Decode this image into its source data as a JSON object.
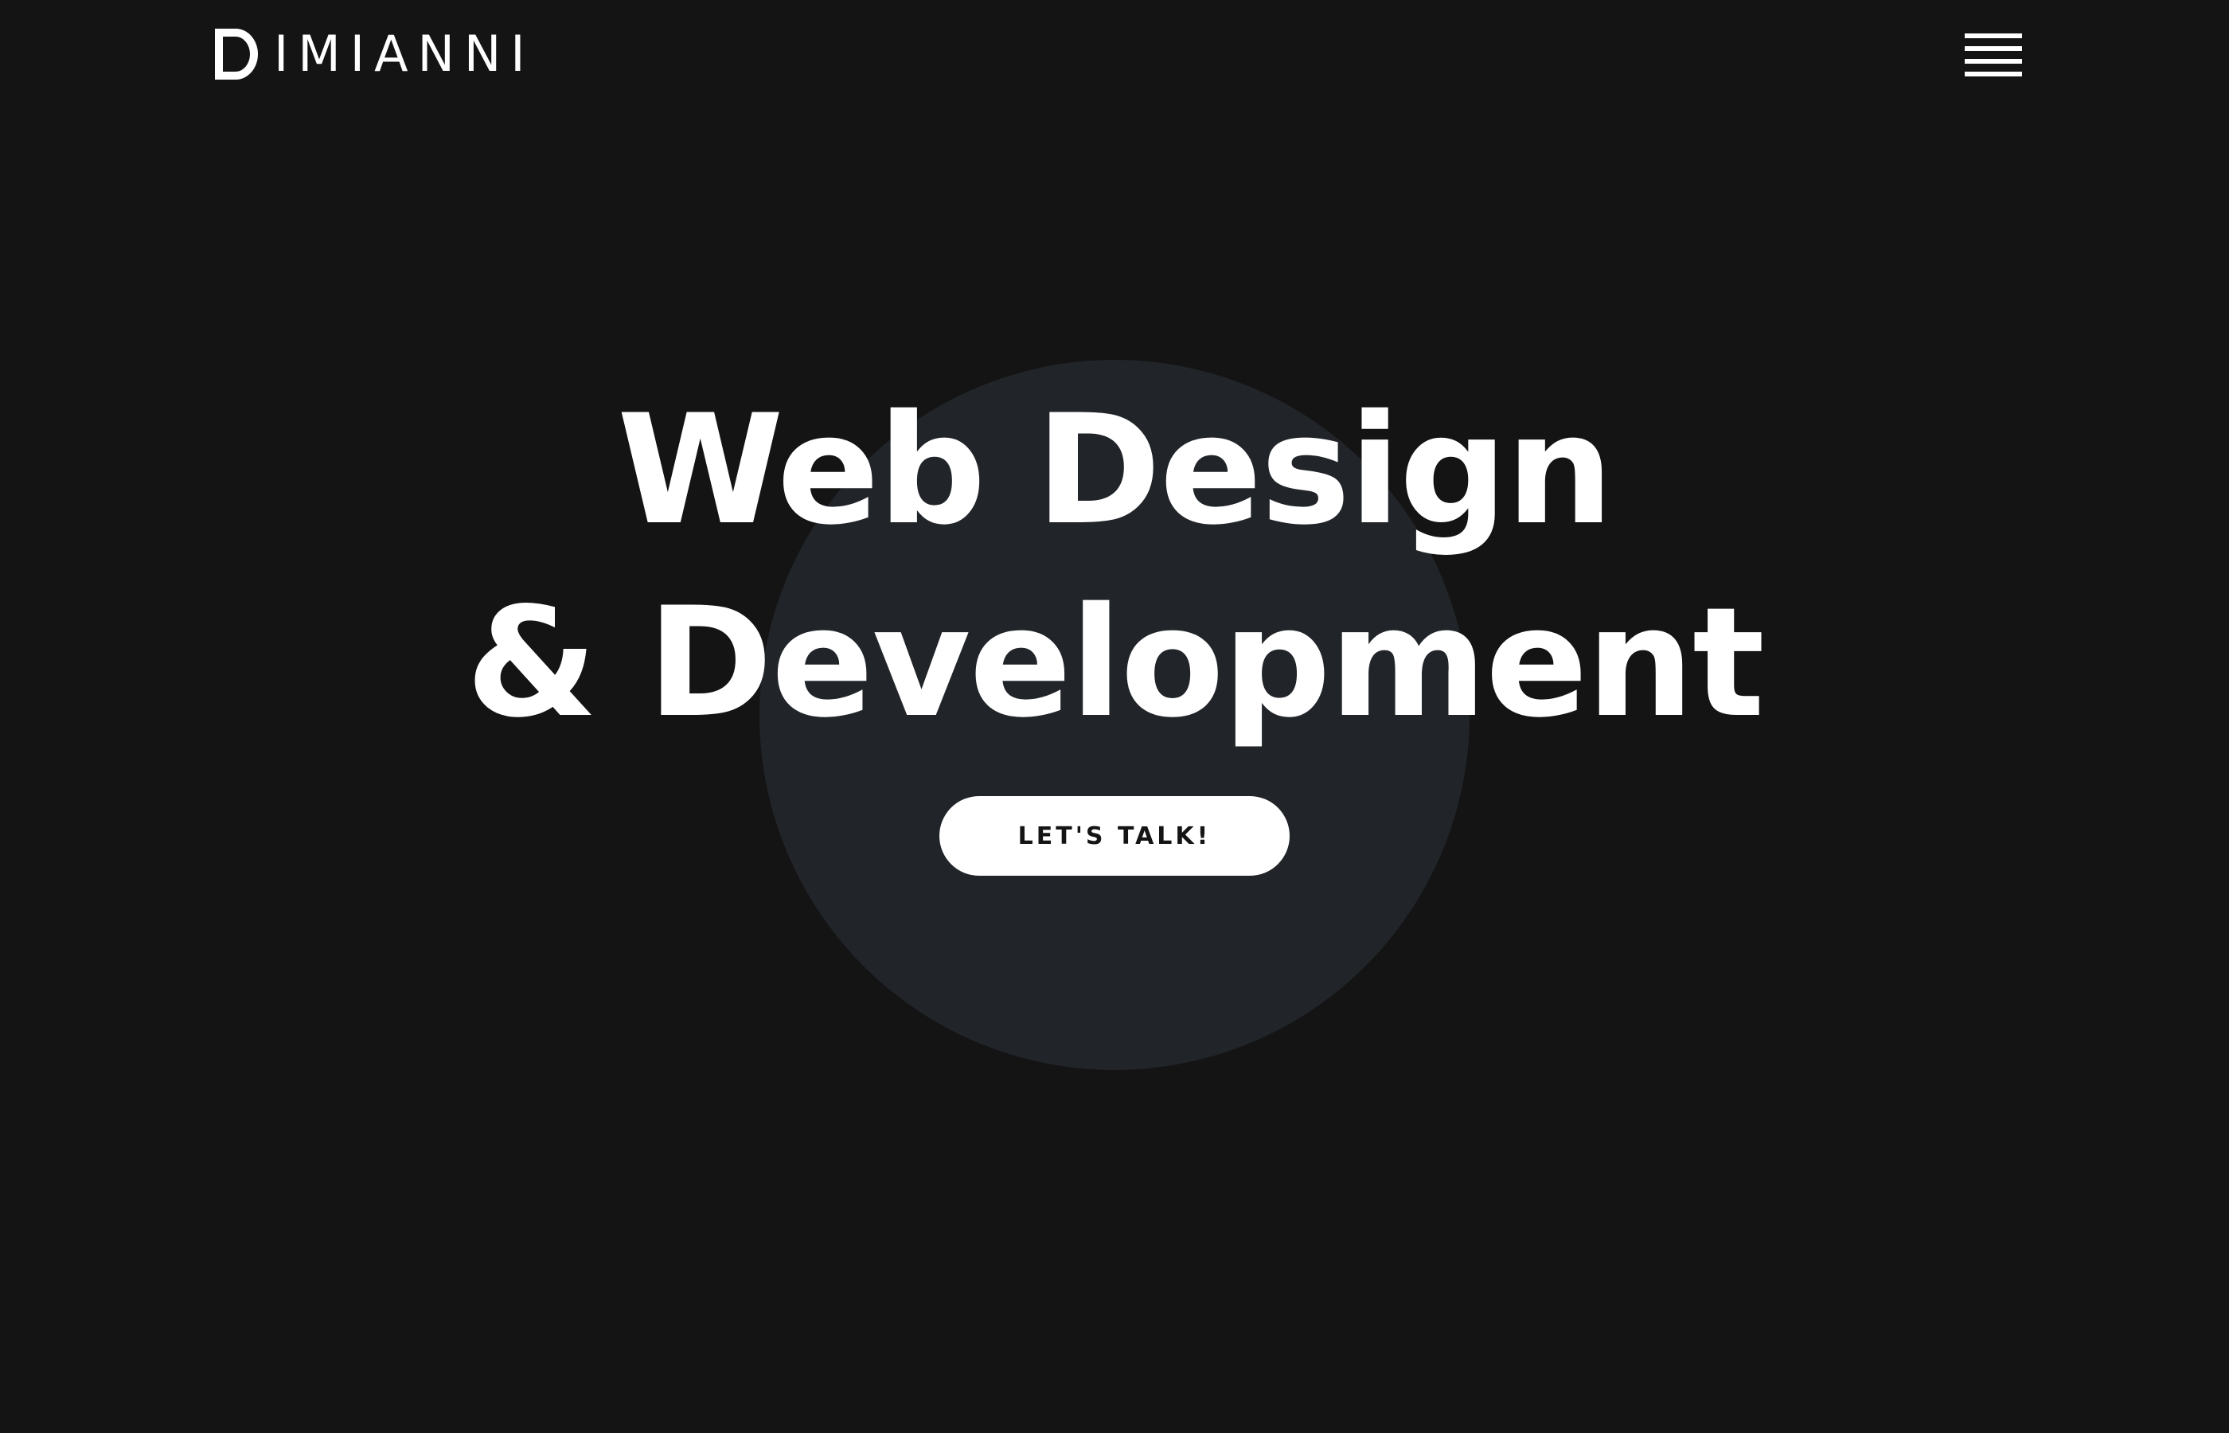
{
  "header": {
    "logo_text": "IMIANNI",
    "logo_full": "DIMIANNI",
    "logo_icon": "d-monogram-icon",
    "menu_icon": "hamburger-menu-icon"
  },
  "hero": {
    "title_line1": "Web Design",
    "title_line2": "& Development",
    "cta_label": "LET'S TALK!"
  },
  "colors": {
    "background": "#141414",
    "circle": "#212429",
    "text": "#ffffff",
    "button_text": "#141414"
  }
}
